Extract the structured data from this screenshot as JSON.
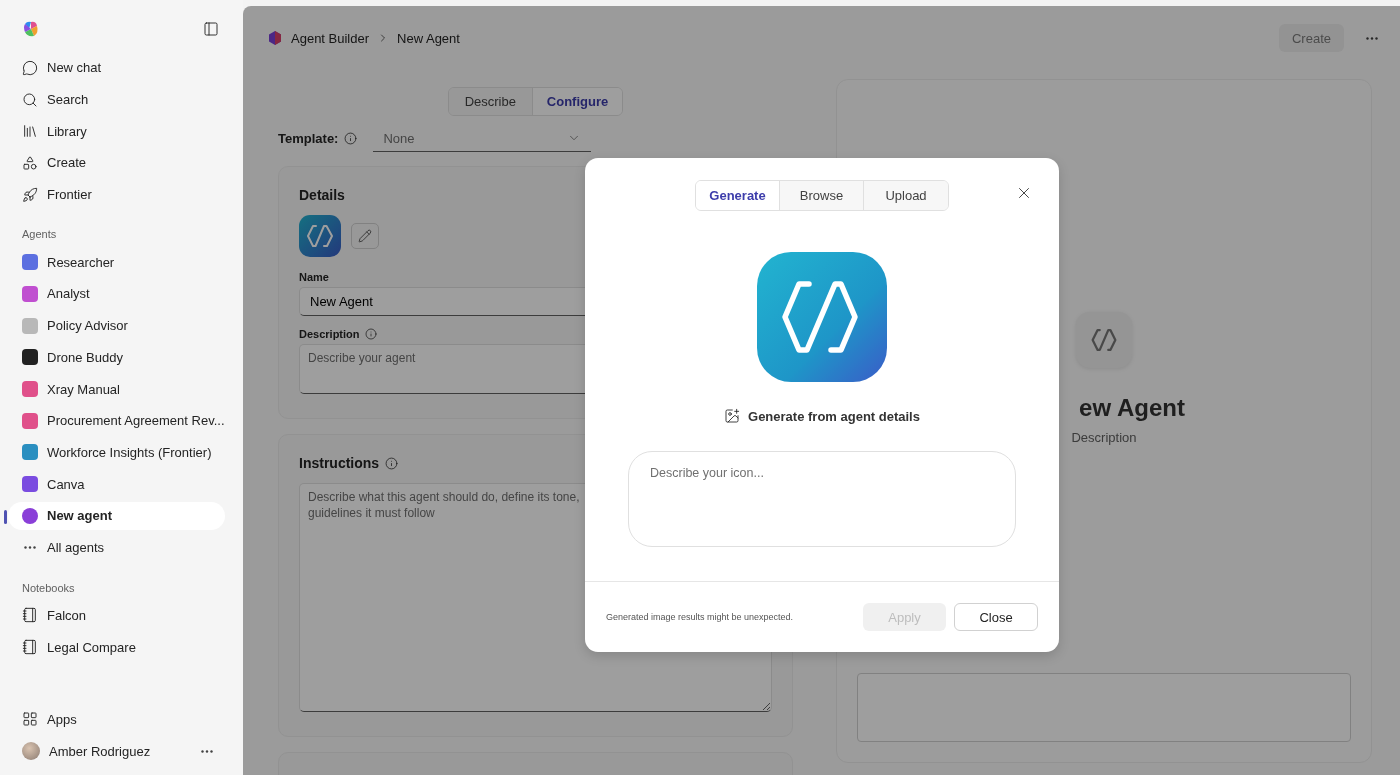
{
  "sidebar": {
    "nav": [
      {
        "kind": "chat",
        "label": "New chat"
      },
      {
        "kind": "search",
        "label": "Search"
      },
      {
        "kind": "library",
        "label": "Library"
      },
      {
        "kind": "create",
        "label": "Create"
      },
      {
        "kind": "rocket",
        "label": "Frontier"
      }
    ],
    "agents_heading": "Agents",
    "agents": [
      {
        "label": "Researcher",
        "selected": false,
        "color": "#5b6fe0"
      },
      {
        "label": "Analyst",
        "selected": false,
        "color": "#c04fd0"
      },
      {
        "label": "Policy Advisor",
        "selected": false,
        "color": "#b8b8b8"
      },
      {
        "label": "Drone Buddy",
        "selected": false,
        "color": "#222222"
      },
      {
        "label": "Xray Manual",
        "selected": false,
        "color": "#e0508a"
      },
      {
        "label": "Procurement Agreement Rev...",
        "selected": false,
        "color": "#e0508a"
      },
      {
        "label": "Workforce Insights (Frontier)",
        "selected": false,
        "color": "#2a8fc0"
      },
      {
        "label": "Canva",
        "selected": false,
        "color": "#7a4ce0"
      },
      {
        "label": "New agent",
        "selected": true,
        "color": "#8a3fd8"
      }
    ],
    "all_agents": "All agents",
    "notebooks_heading": "Notebooks",
    "notebooks": [
      "Falcon",
      "Legal Compare"
    ],
    "apps": "Apps",
    "user": "Amber Rodriguez"
  },
  "header": {
    "breadcrumb": [
      "Agent Builder",
      "New Agent"
    ],
    "create_button": {
      "label": "Create",
      "disabled": true
    }
  },
  "mode_tabs": [
    {
      "label": "Describe",
      "selected": false
    },
    {
      "label": "Configure",
      "selected": true
    }
  ],
  "template": {
    "label": "Template:",
    "value": "None"
  },
  "details": {
    "title": "Details",
    "name_label": "Name",
    "name_value": "New Agent",
    "description_label": "Description",
    "description_placeholder": "Describe your agent"
  },
  "instructions": {
    "title": "Instructions",
    "placeholder": "Describe what this agent should do, define its tone,\nguidelines it must follow"
  },
  "preview": {
    "title": "ew Agent",
    "subtitle": "Description"
  },
  "dialog": {
    "tabs": [
      {
        "label": "Generate",
        "selected": true
      },
      {
        "label": "Browse",
        "selected": false
      },
      {
        "label": "Upload",
        "selected": false
      }
    ],
    "caption": "Generate from agent details",
    "prompt_placeholder": "Describe your icon...",
    "note": "Generated image results might be unexpected.",
    "apply_button": {
      "label": "Apply",
      "disabled": true
    },
    "close_button": "Close"
  }
}
